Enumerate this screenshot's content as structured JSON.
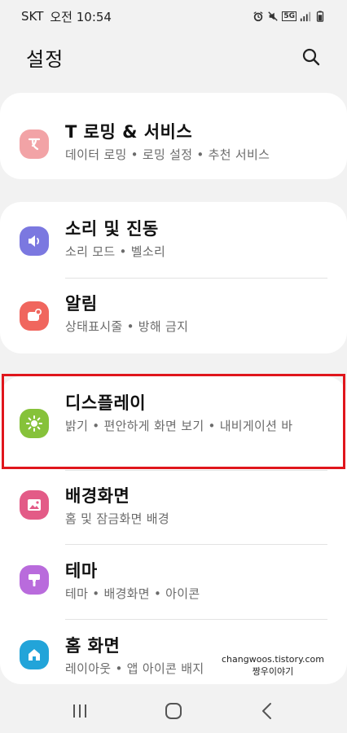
{
  "status": {
    "carrier": "SKT",
    "time": "오전 10:54",
    "net_badge": "5G"
  },
  "header": {
    "title": "설정"
  },
  "groups": [
    {
      "items": [
        {
          "title": "T 로밍 & 서비스",
          "subtitle": "데이터 로밍 • 로밍 설정 • 추천 서비스",
          "icon": "roaming-icon",
          "color": "#f2a3a6"
        }
      ]
    },
    {
      "items": [
        {
          "title": "소리 및 진동",
          "subtitle": "소리 모드 • 벨소리",
          "icon": "speaker-icon",
          "color": "#7b78e0"
        },
        {
          "title": "알림",
          "subtitle": "상태표시줄 • 방해 금지",
          "icon": "notification-icon",
          "color": "#f0665e"
        }
      ]
    },
    {
      "items": [
        {
          "title": "디스플레이",
          "subtitle": "밝기 • 편안하게 화면 보기 • 내비게이션 바",
          "icon": "sun-icon",
          "color": "#86c23a"
        },
        {
          "title": "배경화면",
          "subtitle": "홈 및 잠금화면 배경",
          "icon": "wallpaper-icon",
          "color": "#e35b87"
        },
        {
          "title": "테마",
          "subtitle": "테마 • 배경화면 • 아이콘",
          "icon": "theme-icon",
          "color": "#b96bdc"
        },
        {
          "title": "홈 화면",
          "subtitle": "레이아웃 • 앱 아이콘 배지",
          "icon": "home-icon",
          "color": "#22a4d9"
        }
      ]
    }
  ],
  "watermark": {
    "line1": "changwoos.tistory.com",
    "line2": "짱우이야기"
  },
  "colors": {
    "background": "#f2f2f2",
    "card": "#ffffff",
    "highlight": "#e0161c"
  }
}
